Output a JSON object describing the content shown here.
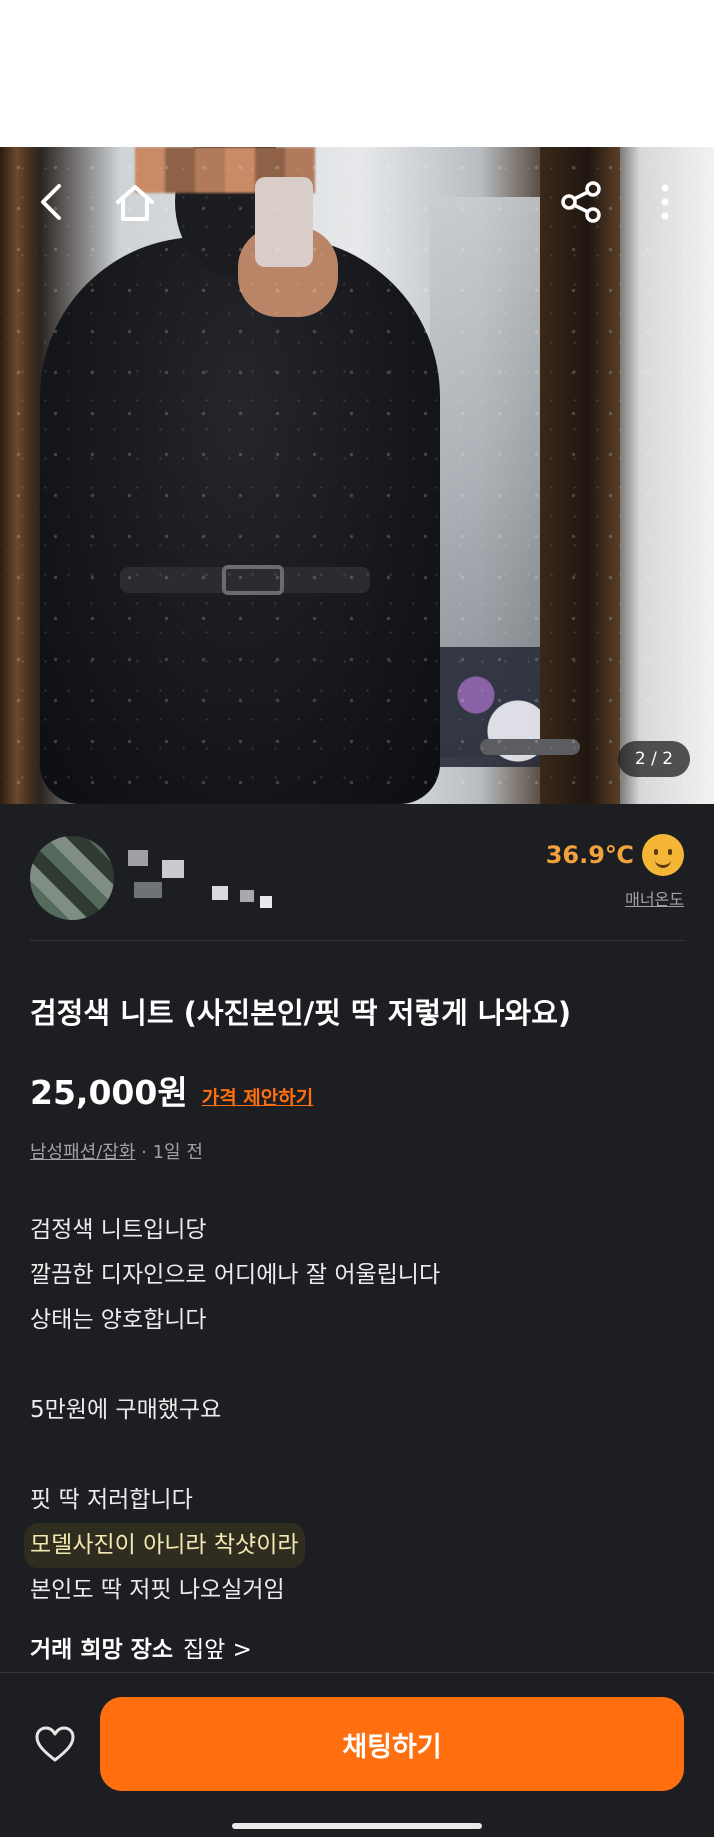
{
  "photo": {
    "page_indicator": "2 / 2"
  },
  "icons": {
    "back": "chevron-left-icon",
    "home": "home-icon",
    "share": "share-icon",
    "more": "more-vertical-icon",
    "like": "heart-icon"
  },
  "seller": {
    "temperature": "36.9℃",
    "manner_label": "매너온도"
  },
  "item": {
    "title": "검정색 니트 (사진본인/핏 딱 저렇게 나와요)",
    "price": "25,000원",
    "offer_label": "가격 제안하기",
    "category": "남성패션/잡화",
    "time": " · 1일 전"
  },
  "description": [
    "검정색 니트입니당",
    "깔끔한 디자인으로 어디에나 잘 어울립니다",
    "상태는 양호합니다",
    "",
    "5만원에 구매했구요",
    "",
    "핏 딱 저러합니다",
    "모델사진이 아니라 착샷이라",
    "본인도 딱 저핏 나오실거임"
  ],
  "place": {
    "label": "거래 희망 장소",
    "value": "집앞 >"
  },
  "bottom": {
    "chat_label": "채팅하기"
  },
  "colors": {
    "accent": "#ff6f0f",
    "temperature": "#f2a23a",
    "background": "#1d1e22"
  }
}
